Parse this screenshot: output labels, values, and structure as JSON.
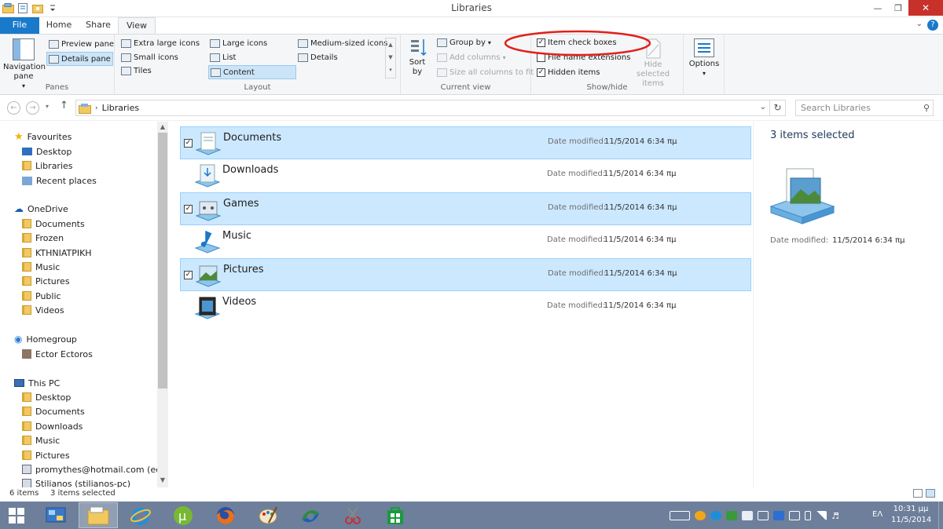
{
  "window": {
    "title": "Libraries"
  },
  "tabs": {
    "file": "File",
    "home": "Home",
    "share": "Share",
    "view": "View",
    "help": "?"
  },
  "ribbon": {
    "panes": {
      "label": "Panes",
      "navigation_pane": "Navigation pane",
      "preview_pane": "Preview pane",
      "details_pane": "Details pane"
    },
    "layout": {
      "label": "Layout",
      "extra_large_icons": "Extra large icons",
      "large_icons": "Large icons",
      "medium_icons": "Medium-sized icons",
      "small_icons": "Small icons",
      "list": "List",
      "details": "Details",
      "tiles": "Tiles",
      "content": "Content"
    },
    "current_view": {
      "label": "Current view",
      "sort_by": "Sort by",
      "group_by": "Group by",
      "add_columns": "Add columns",
      "size_columns": "Size all columns to fit"
    },
    "show_hide": {
      "label": "Show/hide",
      "item_check_boxes": "Item check boxes",
      "item_check_boxes_checked": true,
      "file_name_extensions": "File name extensions",
      "file_name_extensions_checked": false,
      "hidden_items": "Hidden items",
      "hidden_items_checked": true,
      "hide_selected": "Hide selected items"
    },
    "options": {
      "label": "Options"
    },
    "annotation_color": "#e0201b"
  },
  "address": {
    "path": "Libraries",
    "search_placeholder": "Search Libraries"
  },
  "nav": {
    "favourites": {
      "label": "Favourites",
      "items": [
        "Desktop",
        "Libraries",
        "Recent places"
      ]
    },
    "onedrive": {
      "label": "OneDrive",
      "items": [
        "Documents",
        "Frozen",
        "KTHNIATPIKH",
        "Music",
        "Pictures",
        "Public",
        "Videos"
      ]
    },
    "homegroup": {
      "label": "Homegroup",
      "items": [
        "Ector Ectoros"
      ]
    },
    "thispc": {
      "label": "This PC",
      "items": [
        "Desktop",
        "Documents",
        "Downloads",
        "Music",
        "Pictures",
        "promythes@hotmail.com (ectort",
        "Stilianos (stilianos-pc)"
      ]
    }
  },
  "content": {
    "date_label": "Date modified:",
    "items": [
      {
        "name": "Documents",
        "date": "11/5/2014 6:34 πμ",
        "selected": true
      },
      {
        "name": "Downloads",
        "date": "11/5/2014 6:34 πμ",
        "selected": false
      },
      {
        "name": "Games",
        "date": "11/5/2014 6:34 πμ",
        "selected": true
      },
      {
        "name": "Music",
        "date": "11/5/2014 6:34 πμ",
        "selected": false
      },
      {
        "name": "Pictures",
        "date": "11/5/2014 6:34 πμ",
        "selected": true
      },
      {
        "name": "Videos",
        "date": "11/5/2014 6:34 πμ",
        "selected": false
      }
    ]
  },
  "details": {
    "selected_count": "3 items selected",
    "date_label": "Date modified:",
    "date_value": "11/5/2014 6:34 πμ"
  },
  "status": {
    "item_count": "6 items",
    "selected": "3 items selected"
  },
  "taskbar": {
    "language": "ΕΛ",
    "time": "10:31 μμ",
    "date": "11/5/2014"
  }
}
